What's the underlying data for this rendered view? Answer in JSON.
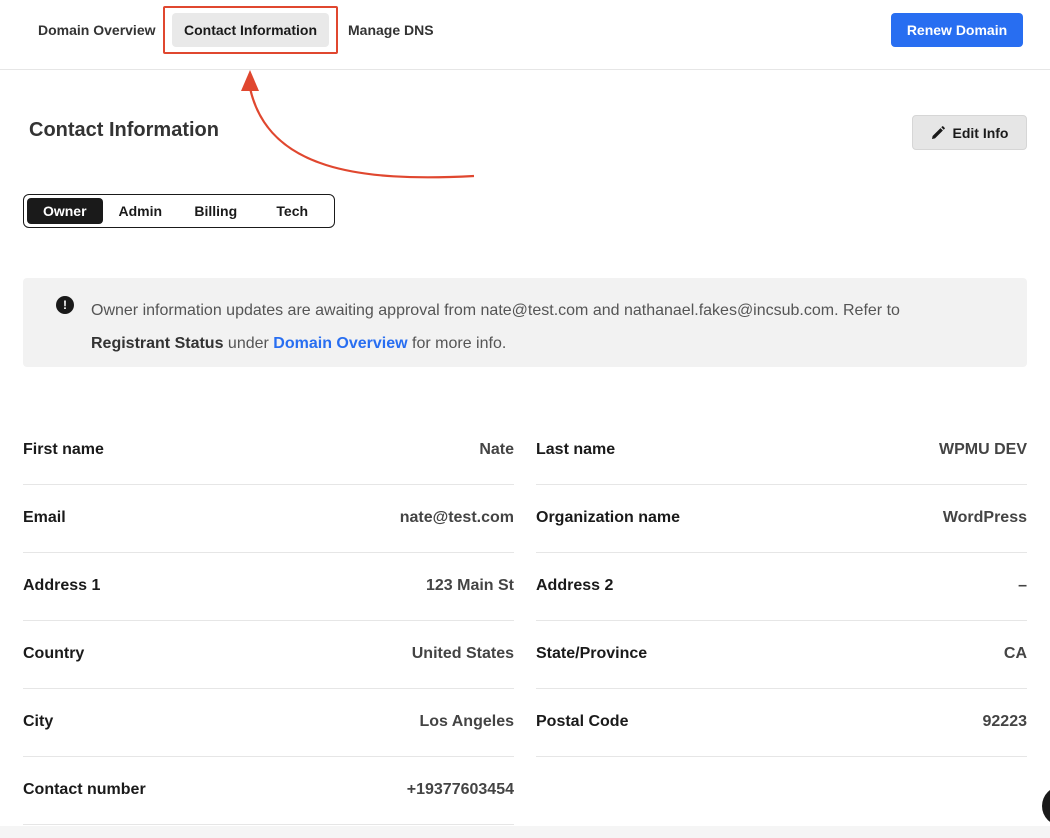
{
  "nav": {
    "tabs": [
      {
        "label": "Domain Overview"
      },
      {
        "label": "Contact Information"
      },
      {
        "label": "Manage DNS"
      }
    ],
    "active": "Contact Information",
    "renew_label": "Renew Domain"
  },
  "colors": {
    "accent": "#286ef1",
    "highlight": "#e0472f"
  },
  "header": {
    "title": "Contact Information",
    "edit_label": "Edit Info",
    "edit_icon": "pencil-icon"
  },
  "contact_types": {
    "items": [
      "Owner",
      "Admin",
      "Billing",
      "Tech"
    ],
    "selected": "Owner"
  },
  "notice": {
    "icon": "alert-icon",
    "text_1": "Owner information updates are awaiting approval from nate@test.com and nathanael.fakes@incsub.com. Refer to",
    "bold": "Registrant Status",
    "under": "under",
    "link": "Domain Overview",
    "tail": "for more info."
  },
  "fields": {
    "first_name": {
      "label": "First name",
      "value": "Nate"
    },
    "last_name": {
      "label": "Last name",
      "value": "WPMU DEV"
    },
    "email": {
      "label": "Email",
      "value": "nate@test.com"
    },
    "organization": {
      "label": "Organization name",
      "value": "WordPress"
    },
    "address1": {
      "label": "Address 1",
      "value": "123 Main St"
    },
    "address2": {
      "label": "Address 2",
      "value": "–"
    },
    "country": {
      "label": "Country",
      "value": "United States"
    },
    "state": {
      "label": "State/Province",
      "value": "CA"
    },
    "city": {
      "label": "City",
      "value": "Los Angeles"
    },
    "postal": {
      "label": "Postal Code",
      "value": "92223"
    },
    "phone": {
      "label": "Contact number",
      "value": "+19377603454"
    }
  }
}
